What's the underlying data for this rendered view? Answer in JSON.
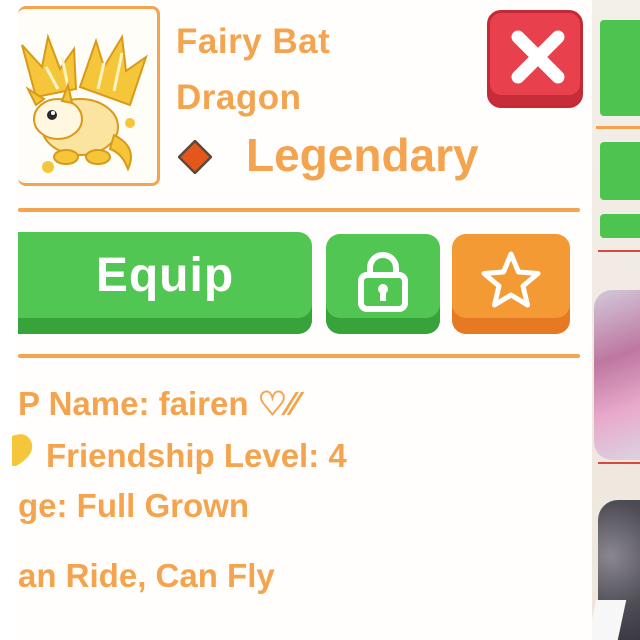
{
  "pet": {
    "name_line1": "Fairy Bat",
    "name_line2": "Dragon",
    "rarity": "Legendary",
    "rarity_color": "#e5561b",
    "art_icon": "fairy-bat-dragon-icon"
  },
  "actions": {
    "equip_label": "Equip",
    "lock_icon": "lock-icon",
    "favorite_icon": "star-icon",
    "close_icon": "close-icon"
  },
  "info": {
    "name_line": "P Name: fairen ♡⁄⁄",
    "friendship_line": "Friendship Level: 4",
    "age_line": "ge: Full Grown",
    "abilities_line": "an Ride, Can Fly"
  },
  "colors": {
    "accent_orange": "#f4a44e",
    "green_button": "#52c653",
    "close_red": "#e8404c",
    "star_orange": "#f39a34"
  }
}
